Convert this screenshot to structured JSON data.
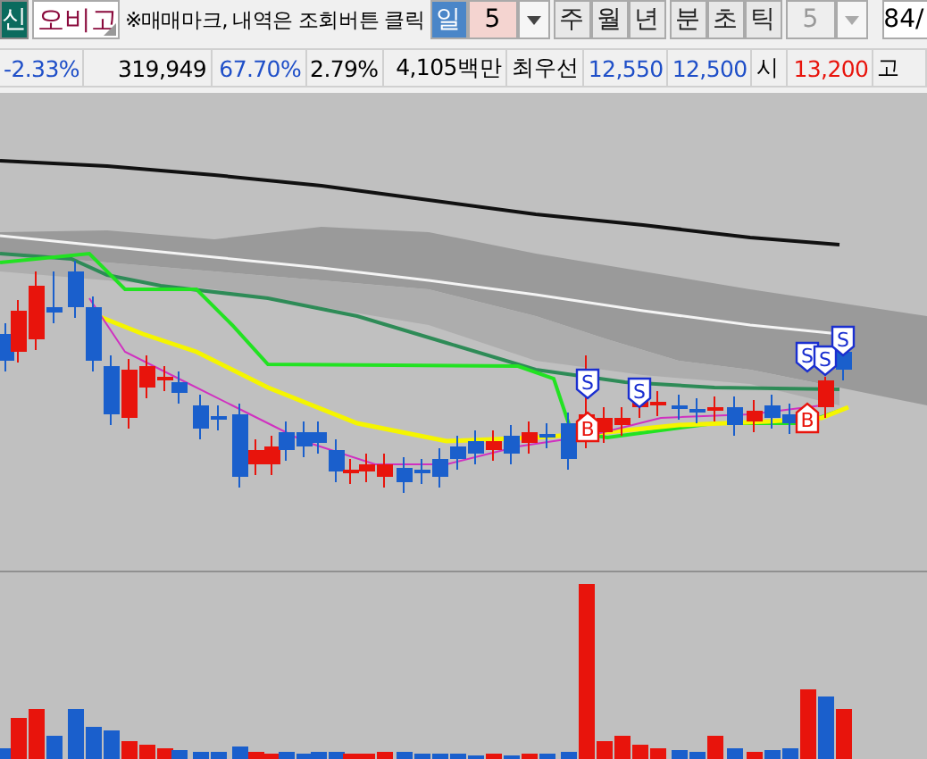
{
  "stock": {
    "market_badge": "신",
    "name": "오비고"
  },
  "notice": "※매매마크, 내역은 조회버튼 클릭",
  "period_tabs": [
    {
      "label": "일",
      "selected": true
    },
    {
      "label": "주",
      "selected": false
    },
    {
      "label": "월",
      "selected": false
    },
    {
      "label": "년",
      "selected": false
    },
    {
      "label": "분",
      "selected": false
    },
    {
      "label": "초",
      "selected": false
    },
    {
      "label": "틱",
      "selected": false
    }
  ],
  "day_count": "5",
  "intraday_count": {
    "value": "5",
    "disabled": true
  },
  "view_count": "84/",
  "quotes": [
    {
      "text": "-2.33%",
      "color": "#1f4fc8"
    },
    {
      "text": "319,949",
      "color": "#000000"
    },
    {
      "text": "67.70%",
      "color": "#1f4fc8"
    },
    {
      "text": "2.79%",
      "color": "#000000"
    },
    {
      "text": "4,105백만",
      "color": "#000000"
    },
    {
      "text": "최우선",
      "color": "#000000"
    },
    {
      "text": "12,550",
      "color": "#1f4fc8"
    },
    {
      "text": "12,500",
      "color": "#1f4fc8"
    },
    {
      "text": "시",
      "color": "#000000"
    },
    {
      "text": "13,200",
      "color": "#e8140c"
    },
    {
      "text": "고",
      "color": "#000000"
    }
  ],
  "trade_marks": [
    {
      "label": "S",
      "kind": "sell"
    },
    {
      "label": "B",
      "kind": "buy"
    },
    {
      "label": "S",
      "kind": "sell"
    },
    {
      "label": "S",
      "kind": "sell"
    },
    {
      "label": "S",
      "kind": "sell"
    },
    {
      "label": "S",
      "kind": "sell"
    },
    {
      "label": "B",
      "kind": "buy"
    }
  ]
}
